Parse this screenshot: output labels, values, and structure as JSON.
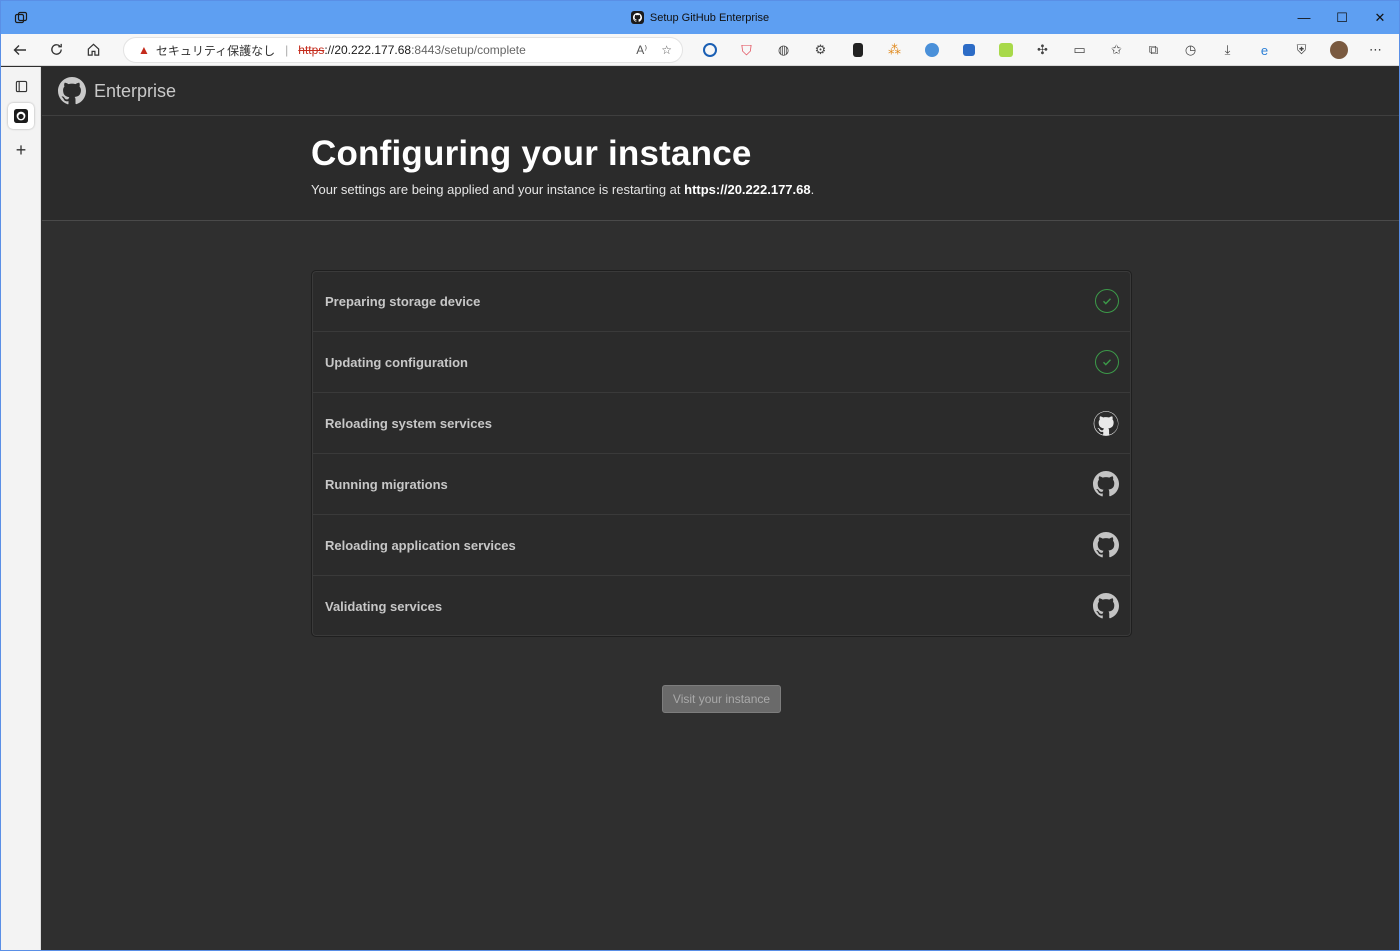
{
  "window": {
    "title": "Setup GitHub Enterprise",
    "controls": {
      "minimize": "—",
      "maximize": "☐",
      "close": "✕"
    }
  },
  "toolbar": {
    "security_text": "セキュリティ保護なし",
    "separator": "|",
    "url_scheme": "https",
    "url_host": "://20.222.177.68",
    "url_path": ":8443/setup/complete"
  },
  "page": {
    "brand": "Enterprise",
    "heading": "Configuring your instance",
    "subtitle_prefix": "Your settings are being applied and your instance is restarting at ",
    "subtitle_url": "https://20.222.177.68",
    "subtitle_suffix": ".",
    "steps": [
      {
        "label": "Preparing storage device",
        "status": "done"
      },
      {
        "label": "Updating configuration",
        "status": "done"
      },
      {
        "label": "Reloading system services",
        "status": "in-progress"
      },
      {
        "label": "Running migrations",
        "status": "pending"
      },
      {
        "label": "Reloading application services",
        "status": "pending"
      },
      {
        "label": "Validating services",
        "status": "pending"
      }
    ],
    "visit_button": "Visit your instance"
  },
  "colors": {
    "titlebar": "#5e9ff2",
    "check": "#3c9a49",
    "page_bg": "#2f2f2f"
  }
}
